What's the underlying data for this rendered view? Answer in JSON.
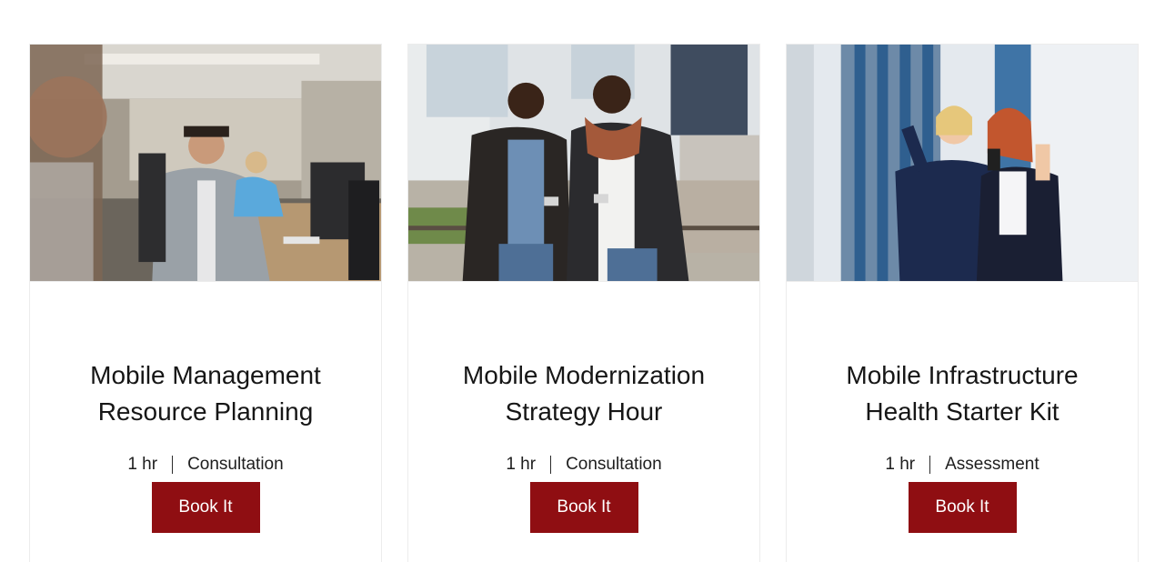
{
  "services": [
    {
      "image_alt": "Office worker with headset smiling at computer in open office",
      "title_line1": "Mobile Management",
      "title_line2": "Resource Planning",
      "duration": "1 hr",
      "category": "Consultation",
      "button_label": "Book It"
    },
    {
      "image_alt": "Two men laughing while looking at smartphones outdoors",
      "title_line1": "Mobile Modernization",
      "title_line2": "Strategy Hour",
      "duration": "1 hr",
      "category": "Consultation",
      "button_label": "Book It"
    },
    {
      "image_alt": "Two businesswomen celebrating while looking at a phone",
      "title_line1": "Mobile Infrastructure",
      "title_line2": "Health Starter Kit",
      "duration": "1 hr",
      "category": "Assessment",
      "button_label": "Book It"
    }
  ],
  "colors": {
    "button_bg": "#8f0e12",
    "button_text": "#ffffff",
    "card_border": "#ececec"
  }
}
